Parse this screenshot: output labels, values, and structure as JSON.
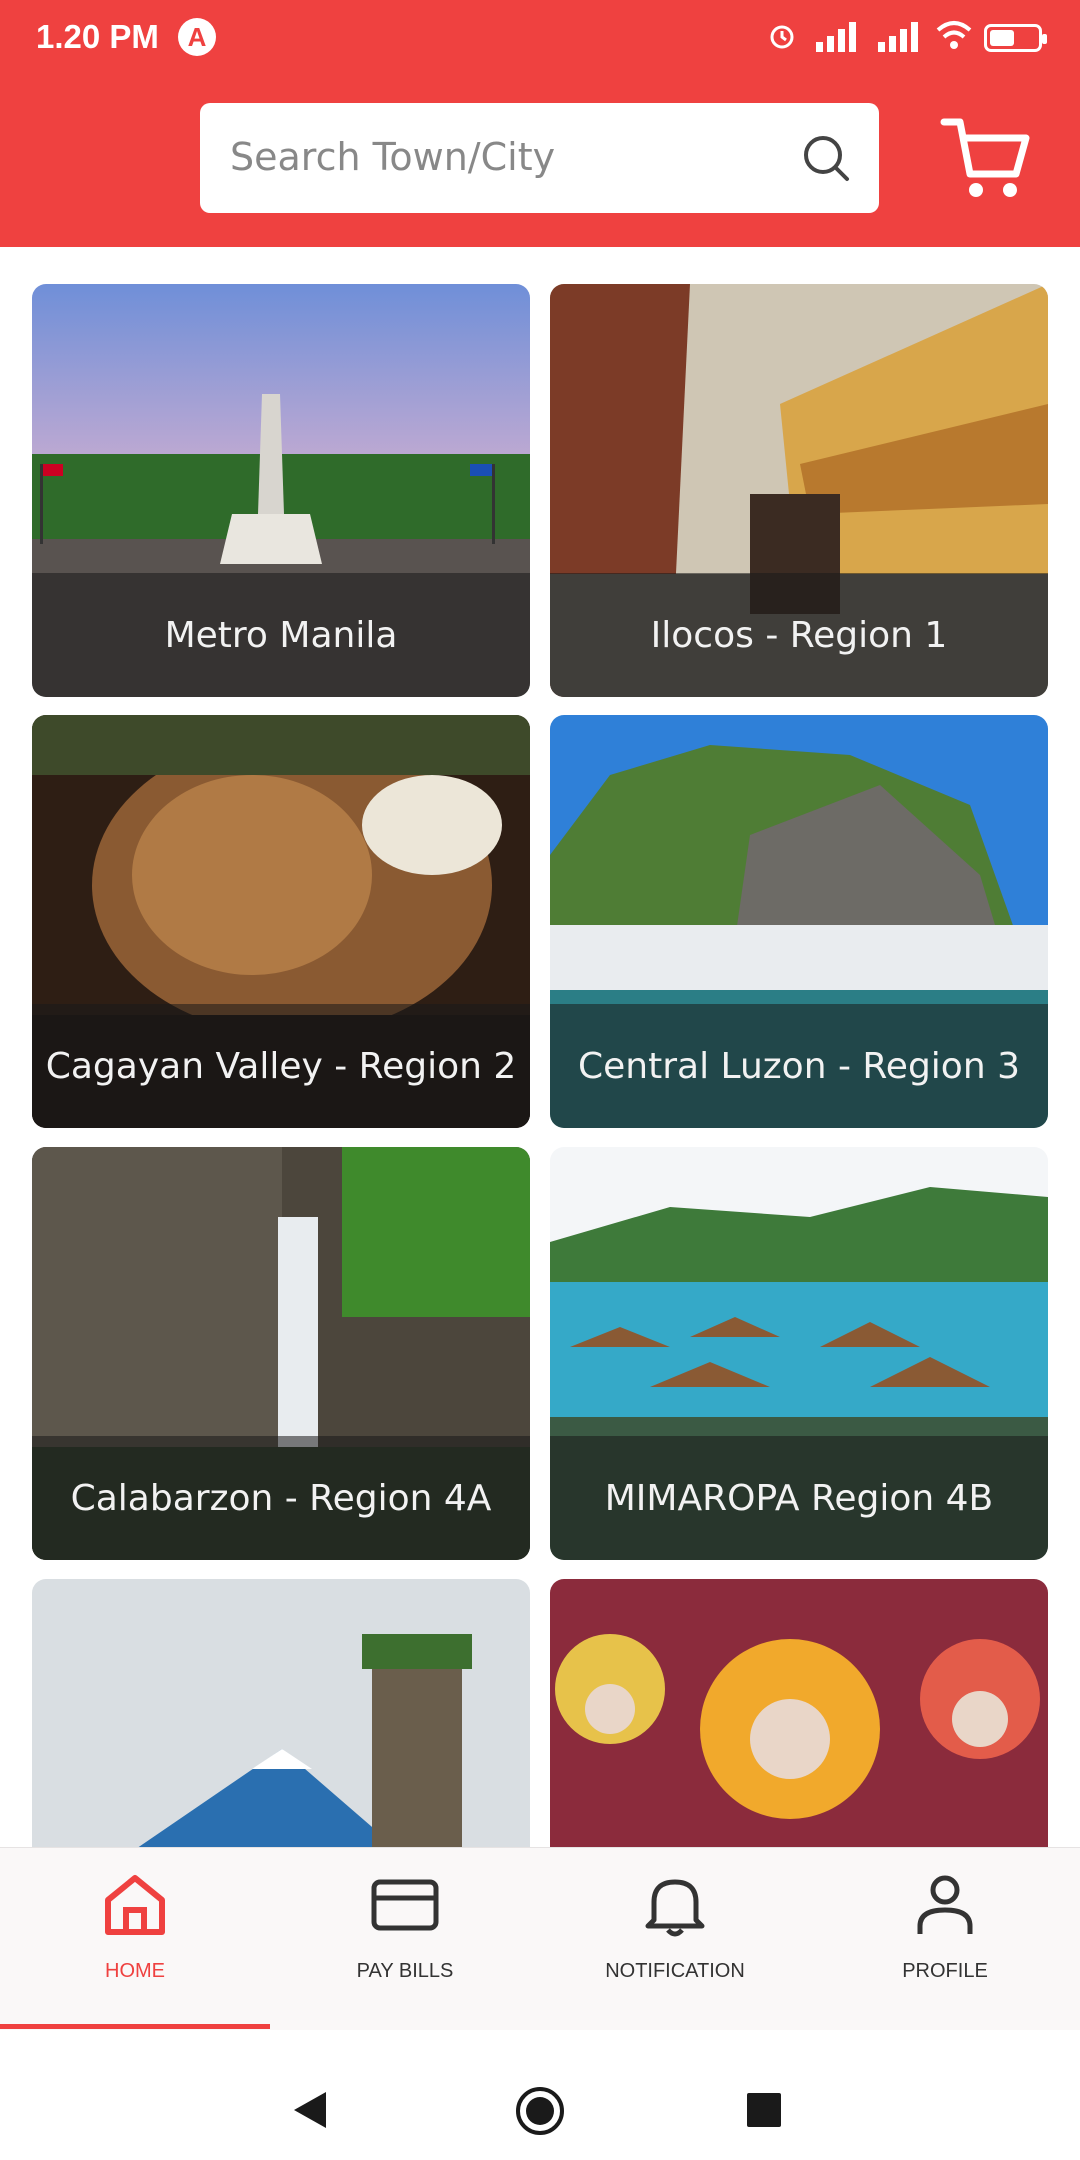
{
  "status_bar": {
    "time": "1.20 PM",
    "app_badge": "A"
  },
  "search": {
    "placeholder": "Search Town/City"
  },
  "regions": [
    {
      "label": "Metro Manila"
    },
    {
      "label": "Ilocos - Region 1"
    },
    {
      "label": "Cagayan Valley - Region 2"
    },
    {
      "label": "Central Luzon - Region 3"
    },
    {
      "label": "Calabarzon - Region 4A"
    },
    {
      "label": "MIMAROPA Region 4B"
    }
  ],
  "bottom_nav": [
    {
      "label": "HOME",
      "icon": "home-icon",
      "active": true
    },
    {
      "label": "PAY BILLS",
      "icon": "card-icon",
      "active": false
    },
    {
      "label": "NOTIFICATION",
      "icon": "bell-icon",
      "active": false
    },
    {
      "label": "PROFILE",
      "icon": "person-icon",
      "active": false
    }
  ],
  "colors": {
    "brand": "#ef4140",
    "nav_bg": "#faf8f8"
  }
}
